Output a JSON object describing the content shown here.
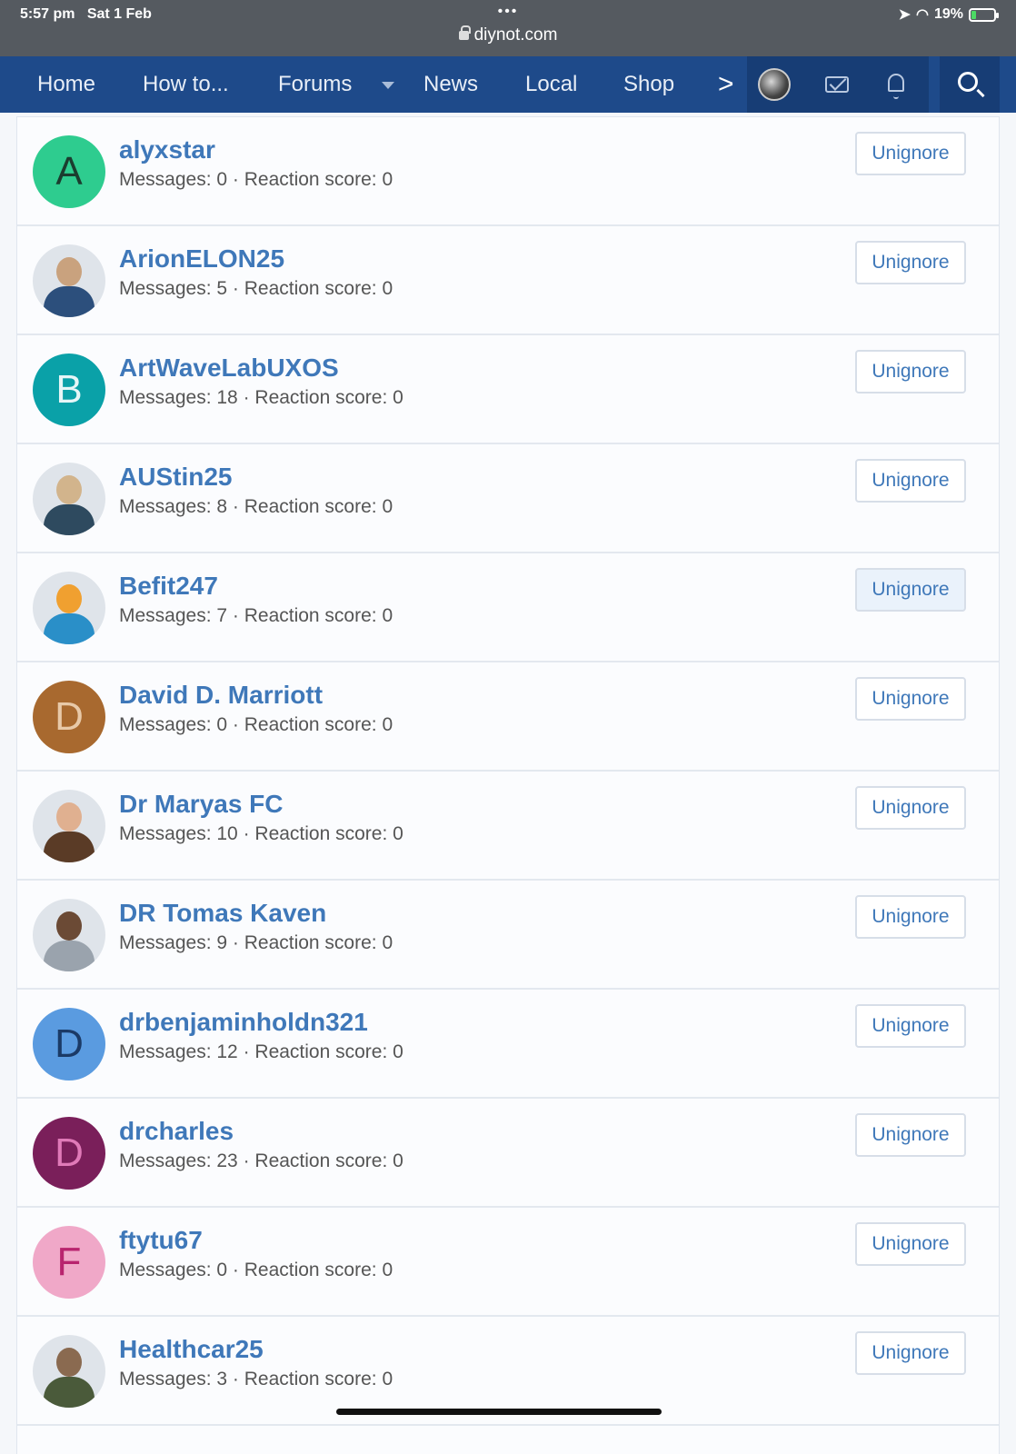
{
  "status": {
    "time": "5:57 pm",
    "date": "Sat 1 Feb",
    "dots": "•••",
    "url": "diynot.com",
    "battery": "19%",
    "battery_level": 0.19
  },
  "nav": {
    "home": "Home",
    "howto": "How to...",
    "forums": "Forums",
    "news": "News",
    "local": "Local",
    "shop": "Shop",
    "more": ">"
  },
  "users": [
    {
      "name": "alyxstar",
      "messages": "Messages: 0 · Reaction score: 0",
      "initial": "A",
      "color": "#2ecc8f",
      "text": "#1b3d2f",
      "photo": false
    },
    {
      "name": "ArionELON25",
      "messages": "Messages: 5 · Reaction score: 0",
      "initial": "",
      "color": "#c9a27e",
      "text": "#2c4f7c",
      "photo": true
    },
    {
      "name": "ArtWaveLabUXOS",
      "messages": "Messages: 18 · Reaction score: 0",
      "initial": "B",
      "color": "#0aa1a8",
      "text": "#e6f6f7",
      "photo": false
    },
    {
      "name": "AUStin25",
      "messages": "Messages: 8 · Reaction score: 0",
      "initial": "",
      "color": "#d2b48c",
      "text": "#2e4a5f",
      "photo": true
    },
    {
      "name": "Befit247",
      "messages": "Messages: 7 · Reaction score: 0",
      "initial": "",
      "color": "#f0a030",
      "text": "#2a8fc8",
      "photo": true
    },
    {
      "name": "David D. Marriott",
      "messages": "Messages: 0 · Reaction score: 0",
      "initial": "D",
      "color": "#a8692f",
      "text": "#e8c9a8",
      "photo": false
    },
    {
      "name": "Dr Maryas FC",
      "messages": "Messages: 10 · Reaction score: 0",
      "initial": "",
      "color": "#e0b090",
      "text": "#5a3b26",
      "photo": true
    },
    {
      "name": "DR Tomas Kaven",
      "messages": "Messages: 9 · Reaction score: 0",
      "initial": "",
      "color": "#6b4a35",
      "text": "#9aa3ad",
      "photo": true
    },
    {
      "name": "drbenjaminholdn321",
      "messages": "Messages: 12 · Reaction score: 0",
      "initial": "D",
      "color": "#5a9be0",
      "text": "#1b3a66",
      "photo": false
    },
    {
      "name": "drcharles",
      "messages": "Messages: 23 · Reaction score: 0",
      "initial": "D",
      "color": "#7a1f5a",
      "text": "#e07ab8",
      "photo": false
    },
    {
      "name": "ftytu67",
      "messages": "Messages: 0 · Reaction score: 0",
      "initial": "F",
      "color": "#f0a8c8",
      "text": "#b8246e",
      "photo": false
    },
    {
      "name": "Healthcar25",
      "messages": "Messages: 3 · Reaction score: 0",
      "initial": "",
      "color": "#8a6a50",
      "text": "#4a5a3a",
      "photo": true
    }
  ],
  "button_label": "Unignore",
  "hovered_index": 4
}
